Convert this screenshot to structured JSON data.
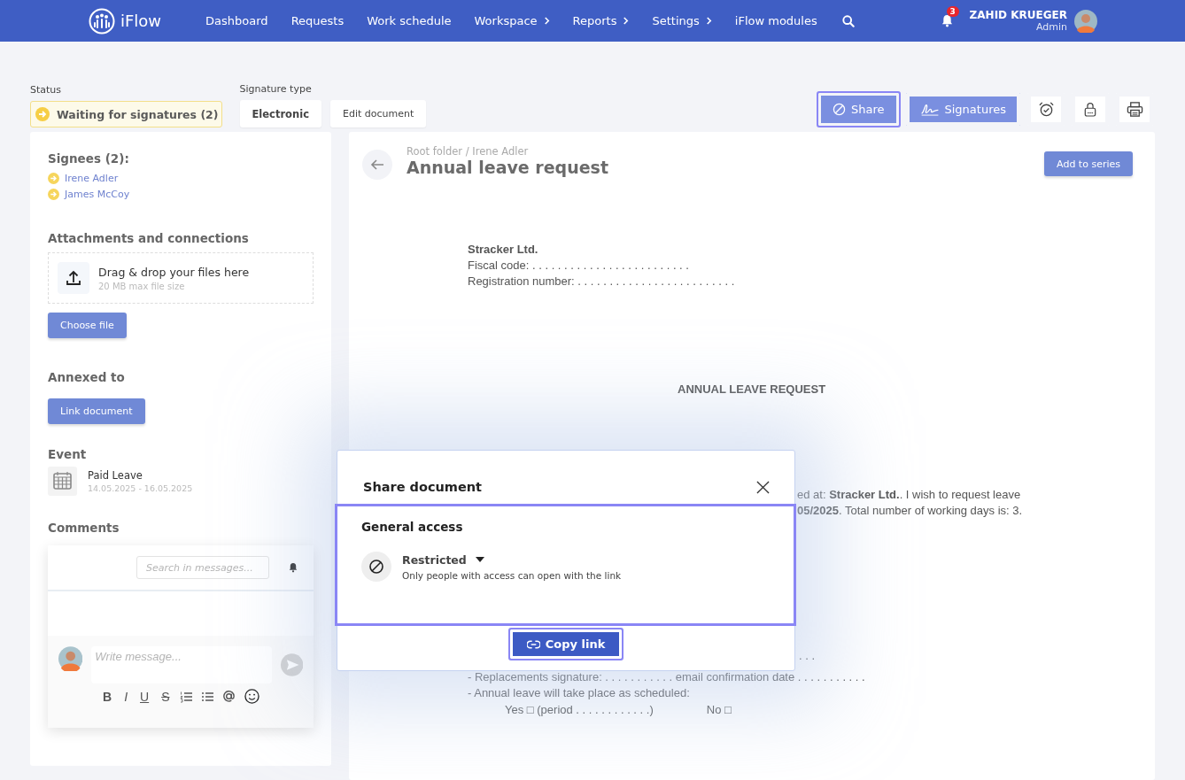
{
  "nav": {
    "logo": "iFlow",
    "items": [
      {
        "label": "Dashboard",
        "submenu": false
      },
      {
        "label": "Requests",
        "submenu": false
      },
      {
        "label": "Work schedule",
        "submenu": false
      },
      {
        "label": "Workspace",
        "submenu": true
      },
      {
        "label": "Reports",
        "submenu": true
      },
      {
        "label": "Settings",
        "submenu": true
      },
      {
        "label": "iFlow modules",
        "submenu": false
      }
    ],
    "notifications": "3",
    "user": "ZAHID KRUEGER",
    "role": "Admin"
  },
  "toolbar": {
    "status_label": "Status",
    "status": "Waiting for signatures (2)",
    "signature_label": "Signature type",
    "signature_options": [
      {
        "label": "Electronic",
        "selected": true
      },
      {
        "label": "Edit document",
        "selected": false
      }
    ],
    "actions": [
      {
        "kind": "share",
        "label": "Share",
        "highlighted": true
      },
      {
        "kind": "signatures",
        "label": "Signatures",
        "highlighted": false
      },
      {
        "kind": "alarm",
        "highlighted": false
      },
      {
        "kind": "lock",
        "highlighted": false
      },
      {
        "kind": "print",
        "highlighted": false
      }
    ]
  },
  "sidebar": {
    "signees_title": "Signees (2):",
    "signees": [
      "Irene Adler",
      "James McCoy"
    ],
    "attachments_title": "Attachments and connections",
    "drop_title": "Drag & drop your files here",
    "drop_hint": "20 MB max file size",
    "choose_button": "Choose file",
    "annexed_title": "Annexed to",
    "link_button": "Link document",
    "event_title": "Event",
    "event_name": "Paid Leave",
    "event_dates": "14.05.2025 - 16.05.2025",
    "comments_title": "Comments",
    "search_placeholder": "Search in messages...",
    "message_placeholder": "Write message...",
    "format_tools": [
      "B",
      "I",
      "U",
      "S"
    ]
  },
  "document": {
    "breadcrumb": "Root folder / Irene Adler",
    "title": "Annual leave request",
    "series_button": "Add to series",
    "company": "Stracker Ltd.",
    "fiscal_code": "Fiscal code:  . . . . . . . . . . . . . . . . . . . . . . . . .",
    "registration": "Registration number:  . . . . . . . . . . . . . . . . . . . . . . . . .",
    "heading": "ANNUAL LEAVE REQUEST",
    "partial_lines": [
      "ed at: **Stracker Ltd.**. I wish to request leave",
      "**05/2025**. Total number of working days is: 3."
    ],
    "dots": ". . .",
    "lower_lines": [
      "- Replacements signature: . . . . . . . . . . . email confirmation date . . . . . . . . . . .",
      "- Annual leave will take place as scheduled:"
    ],
    "yes_option": "Yes □ (period . . . . . . . . . . . .)",
    "no_option": "No □"
  },
  "modal": {
    "title": "Share document",
    "section": "General access",
    "access": "Restricted",
    "access_hint": "Only people with access can open with the link",
    "section_highlighted": true,
    "copy_button": "Copy link",
    "copy_highlighted": true
  }
}
